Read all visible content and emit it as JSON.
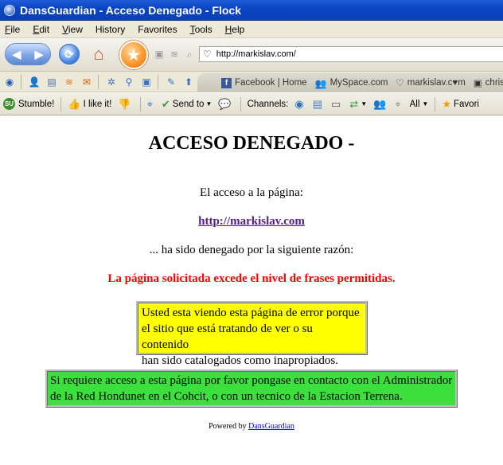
{
  "window": {
    "title": "DansGuardian - Acceso Denegado - Flock"
  },
  "menu": [
    {
      "u": "F",
      "rest": "ile"
    },
    {
      "u": "E",
      "rest": "dit"
    },
    {
      "u": "V",
      "rest": "iew"
    },
    {
      "u": "H",
      "rest": "istory"
    },
    {
      "u": "F",
      "rest": "avorites",
      "alt": "a"
    },
    {
      "u": "T",
      "rest": "ools"
    },
    {
      "u": "H",
      "rest": "elp"
    }
  ],
  "menu_labels": [
    "File",
    "Edit",
    "View",
    "History",
    "Favorites",
    "Tools",
    "Help"
  ],
  "address": {
    "url": "http://markislav.com/"
  },
  "bookmarks": {
    "facebook": "Facebook | Home",
    "myspace": "MySpace.com",
    "markislav": "markislav.c♥m",
    "chris": "chris"
  },
  "stumble": {
    "stumble": "Stumble!",
    "like": "I like it!",
    "sendto": "Send to",
    "channels": "Channels:",
    "all": "All",
    "favorites": "Favori"
  },
  "page": {
    "heading": "ACCESO DENEGADO -",
    "line1": "El acceso a la página:",
    "blocked_url": "http://markislav.com",
    "line2": "... ha sido denegado por la siguiente razón:",
    "reason": "La página solicitada excede el nivel de frases permitidas.",
    "yellow_lines": [
      "Usted esta viendo esta página de error porque",
      "el sitio que está tratando de ver o su contenido",
      "han sido catalogados como inapropiados."
    ],
    "green_lines": [
      "Si requiere acceso a esta página por favor pongase en contacto con el Administrador",
      "de la Red Hondunet en el Cohcit, o con un tecnico de la Estacion Terrena."
    ],
    "powered_prefix": "Powered by ",
    "powered_link": "DansGuardian"
  },
  "colors": {
    "reason_text": "#ff0000",
    "yellow_box": "#ffff00",
    "green_box": "#3ce03c",
    "title_bar": "#0a45c4"
  }
}
